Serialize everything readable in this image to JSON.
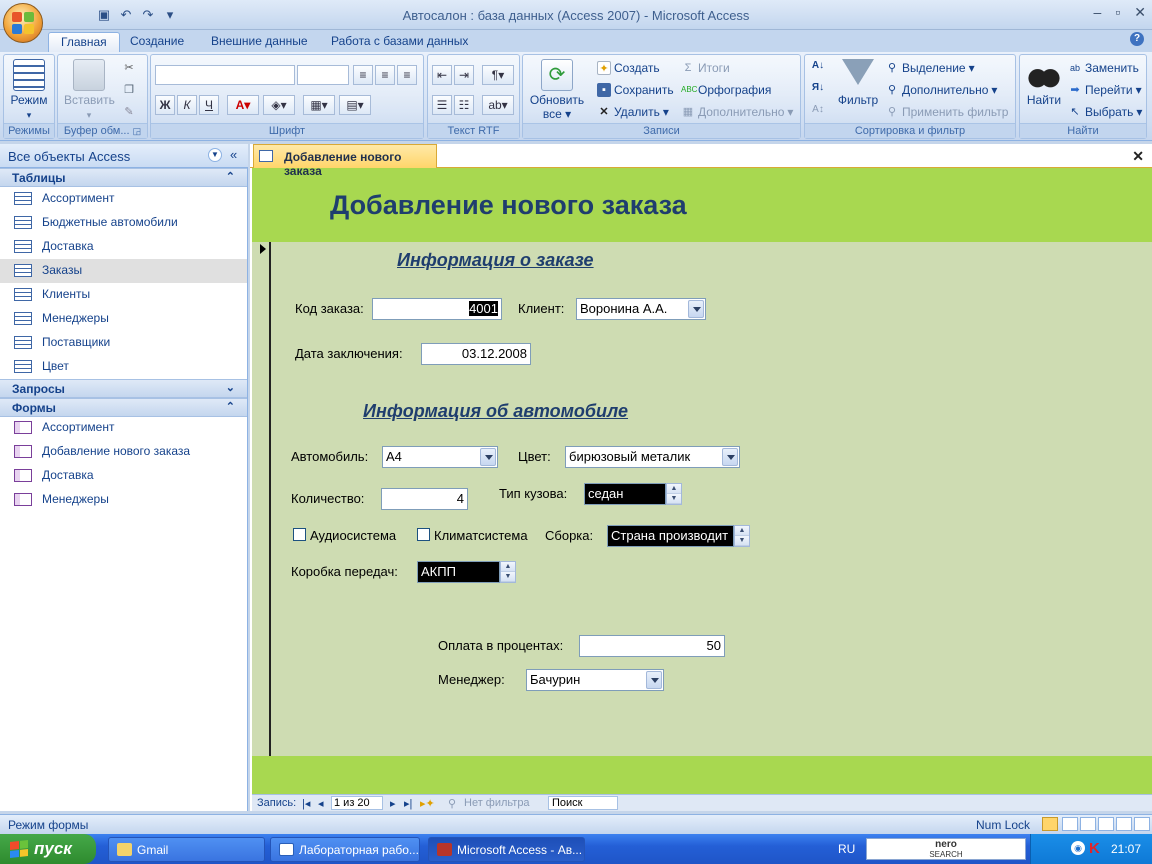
{
  "window": {
    "title": "Автосалон : база данных (Access 2007) - Microsoft Access"
  },
  "ribbon_tabs": [
    "Главная",
    "Создание",
    "Внешние данные",
    "Работа с базами данных"
  ],
  "ribbon": {
    "views": {
      "btn": "Режим",
      "label": "Режимы"
    },
    "clipboard": {
      "btn": "Вставить",
      "label": "Буфер обм..."
    },
    "font": {
      "label": "Шрифт",
      "bold": "Ж",
      "italic": "К",
      "underline": "Ч"
    },
    "rtf": {
      "label": "Текст RTF"
    },
    "records": {
      "label": "Записи",
      "refresh_line1": "Обновить",
      "refresh_line2": "все",
      "create": "Создать",
      "save": "Сохранить",
      "delete": "Удалить",
      "totals": "Итоги",
      "spelling": "Орфография",
      "more": "Дополнительно"
    },
    "sort": {
      "label": "Сортировка и фильтр",
      "filter": "Фильтр",
      "selection": "Выделение",
      "advanced": "Дополнительно",
      "apply": "Применить фильтр"
    },
    "find": {
      "label": "Найти",
      "find": "Найти",
      "replace": "Заменить",
      "goto": "Перейти",
      "select": "Выбрать"
    }
  },
  "nav": {
    "header": "Все объекты Access",
    "groups": {
      "tables": "Таблицы",
      "queries": "Запросы",
      "forms": "Формы"
    },
    "tables": [
      "Ассортимент",
      "Бюджетные автомобили",
      "Доставка",
      "Заказы",
      "Клиенты",
      "Менеджеры",
      "Поставщики",
      "Цвет"
    ],
    "forms": [
      "Ассортимент",
      "Добавление нового заказа",
      "Доставка",
      "Менеджеры"
    ]
  },
  "doc_tab": "Добавление нового заказа",
  "form": {
    "title": "Добавление нового заказа",
    "section_order": "Информация о заказе",
    "section_car": "Информация об автомобиле",
    "order_code_label": "Код заказа:",
    "order_code": "4001",
    "client_label": "Клиент:",
    "client": "Воронина А.А.",
    "date_label": "Дата заключения:",
    "date": "03.12.2008",
    "car_label": "Автомобиль:",
    "car": "A4",
    "color_label": "Цвет:",
    "color": "бирюзовый металик",
    "qty_label": "Количество:",
    "qty": "4",
    "body_label": "Тип кузова:",
    "body": "седан",
    "audio_label": "Аудиосистема",
    "climate_label": "Климатсистема",
    "assembly_label": "Сборка:",
    "assembly": "Страна производит",
    "gearbox_label": "Коробка передач:",
    "gearbox": "АКПП",
    "payment_label": "Оплата в процентах:",
    "payment": "50",
    "manager_label": "Менеджер:",
    "manager": "Бачурин"
  },
  "record_nav": {
    "label": "Запись:",
    "position": "1 из 20",
    "filter": "Нет фильтра",
    "search": "Поиск"
  },
  "status": {
    "mode": "Режим формы",
    "numlock": "Num Lock"
  },
  "taskbar": {
    "start": "пуск",
    "tasks": [
      "Gmail",
      "Лабораторная рабо...",
      "Microsoft Access - Ав..."
    ],
    "lang": "RU",
    "clock": "21:07",
    "search_brand_1": "nero",
    "search_brand_2": "SEARCH"
  }
}
